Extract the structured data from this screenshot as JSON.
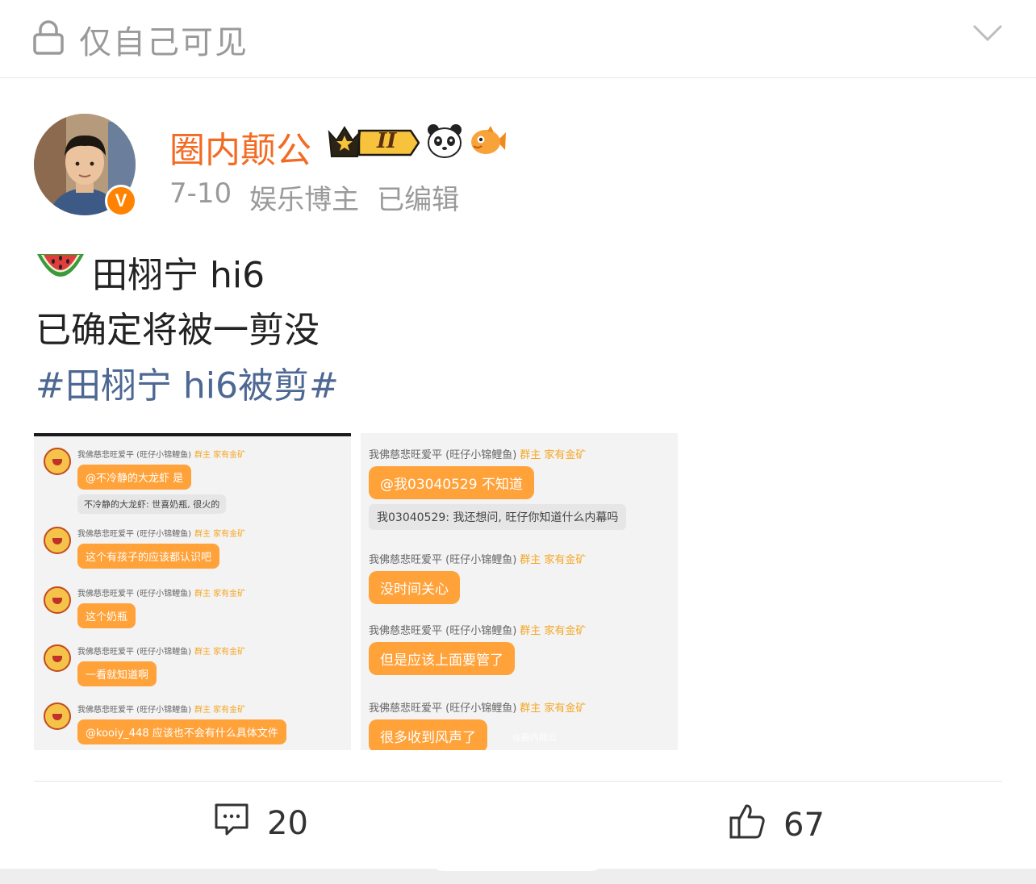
{
  "topbar": {
    "privacy_icon": "lock-icon",
    "privacy_label": "仅自己可见",
    "menu_icon": "chevron-down-icon"
  },
  "author": {
    "name": "圈内颠公",
    "crown_level": "II",
    "badge_icons": [
      "crown-level-badge",
      "panda-icon",
      "fish-icon"
    ],
    "verified_mark": "V",
    "date": "7-10",
    "category": "娱乐博主",
    "edited": "已编辑"
  },
  "post": {
    "emoji": "watermelon-icon",
    "line1": "田栩宁 hi6",
    "line2": "已确定将被一剪没",
    "hashtag": "#田栩宁 hi6被剪#"
  },
  "images": {
    "image1": {
      "messages": [
        {
          "name": "我佛慈悲旺爱平 (旺仔小锦鲤鱼)",
          "tags": "群主  家有金矿",
          "text": "@不冷静的大龙虾 是",
          "quote": "不冷静的大龙虾: 世喜奶瓶, 很火的"
        },
        {
          "name": "我佛慈悲旺爱平 (旺仔小锦鲤鱼)",
          "tags": "群主  家有金矿",
          "text": "这个有孩子的应该都认识吧"
        },
        {
          "name": "我佛慈悲旺爱平 (旺仔小锦鲤鱼)",
          "tags": "群主  家有金矿",
          "text": "这个奶瓶"
        },
        {
          "name": "我佛慈悲旺爱平 (旺仔小锦鲤鱼)",
          "tags": "群主  家有金矿",
          "text": "一看就知道啊"
        },
        {
          "name": "我佛慈悲旺爱平 (旺仔小锦鲤鱼)",
          "tags": "群主  家有金矿",
          "text": "@kooiy_448 应该也不会有什么具体文件"
        }
      ]
    },
    "image2": {
      "messages": [
        {
          "name": "我佛慈悲旺爱平 (旺仔小锦鲤鱼)",
          "tags": "群主  家有金矿",
          "text": "@我03040529 不知道",
          "quote": "我03040529: 我还想问, 旺仔你知道什么内幕吗"
        },
        {
          "name": "我佛慈悲旺爱平 (旺仔小锦鲤鱼)",
          "tags": "群主  家有金矿",
          "text": "没时间关心"
        },
        {
          "name": "我佛慈悲旺爱平 (旺仔小锦鲤鱼)",
          "tags": "群主  家有金矿",
          "text": "但是应该上面要管了"
        },
        {
          "name": "我佛慈悲旺爱平 (旺仔小锦鲤鱼)",
          "tags": "群主  家有金矿",
          "text": "很多收到风声了"
        }
      ],
      "watermark": "@圈内颠公"
    }
  },
  "actions": {
    "comment_icon": "comment-icon",
    "comment_count": "20",
    "like_icon": "thumbs-up-icon",
    "like_count": "67"
  },
  "colors": {
    "username": "#f36b22",
    "hashtag": "#4d6892",
    "bubble": "#ffa23a",
    "verified": "#ff8200"
  }
}
